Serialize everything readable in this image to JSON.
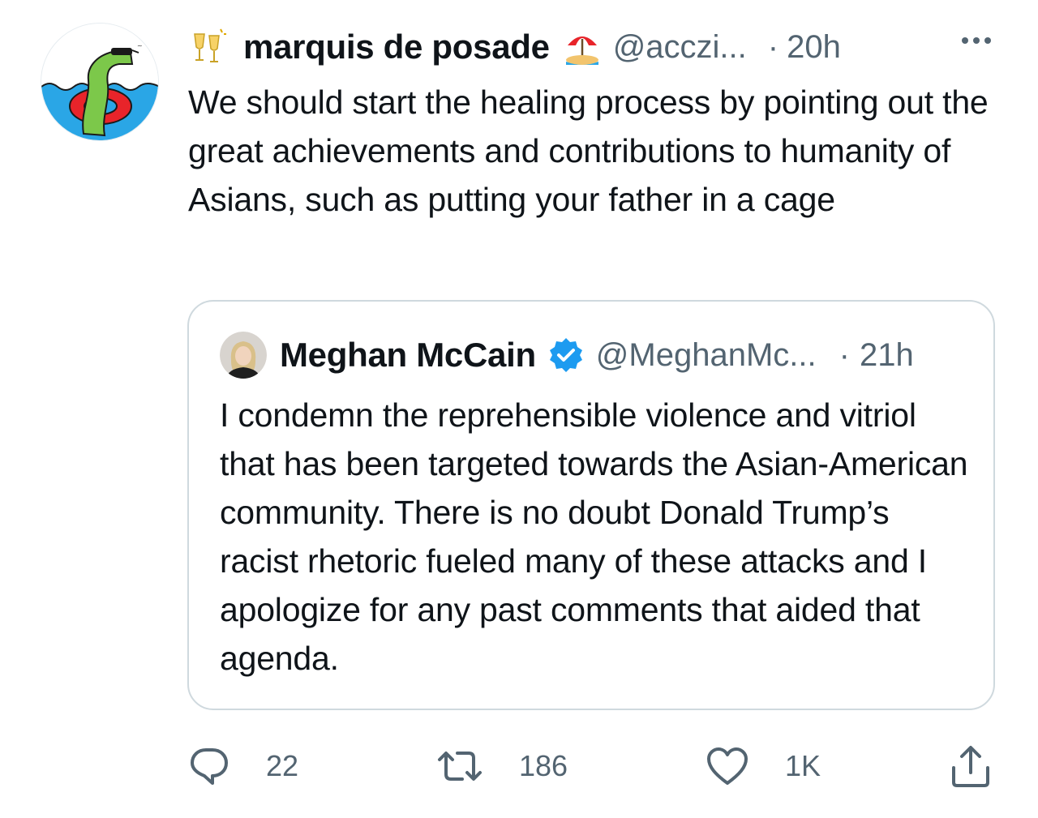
{
  "tweet": {
    "author": {
      "display_name": "marquis de posade",
      "handle": "@acczi...",
      "time": "20h",
      "leading_emoji": "clinking-glasses-icon",
      "trailing_emoji": "beach-umbrella-icon"
    },
    "separator": "·",
    "text": "We should start the healing process by pointing out the great achievements and contributions to humanity of Asians, such as putting your father in a cage"
  },
  "quoted_tweet": {
    "author": {
      "display_name": "Meghan McCain",
      "handle": "@MeghanMc...",
      "time": "21h",
      "verified": true
    },
    "separator": "·",
    "text": "I condemn the reprehensible violence and vitriol that has been targeted towards the Asian-American community. There is no doubt Donald Trump’s racist rhetoric fueled many of these attacks and I apologize for any past comments that aided that agenda."
  },
  "actions": {
    "reply": {
      "icon": "reply-icon",
      "count": "22"
    },
    "retweet": {
      "icon": "retweet-icon",
      "count": "186"
    },
    "like": {
      "icon": "heart-icon",
      "count": "1K"
    },
    "share": {
      "icon": "share-icon"
    }
  },
  "colors": {
    "text_primary": "#0f1419",
    "text_secondary": "#536471",
    "border": "#cfd9de",
    "verified_blue": "#1d9bf0"
  }
}
